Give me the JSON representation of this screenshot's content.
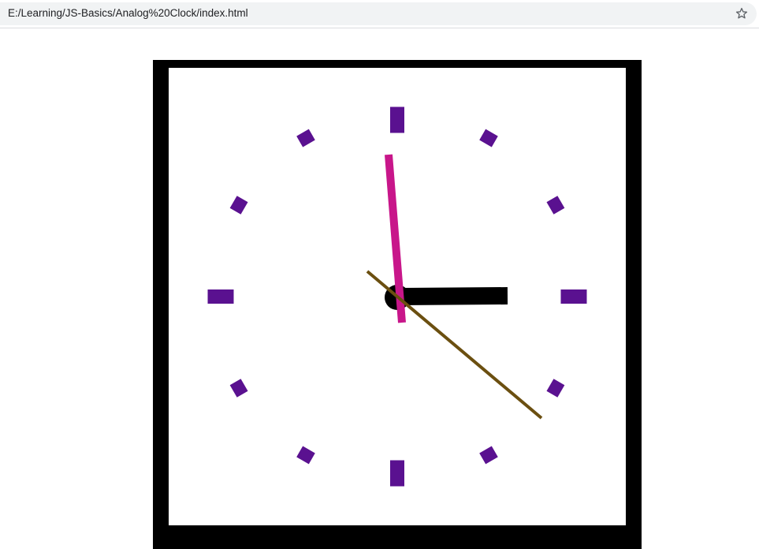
{
  "browser": {
    "url": "E:/Learning/JS-Basics/Analog%20Clock/index.html",
    "bookmark_icon": "star-outline-icon"
  },
  "clock": {
    "colors": {
      "frame": "#000000",
      "face": "#ffffff",
      "hour_marker": "#5a1190",
      "hour_hand": "#000000",
      "minute_hand": "#c8168a",
      "second_hand": "#6b4f10",
      "center_dot": "#000000"
    },
    "time": {
      "hours": 3,
      "minutes": 59,
      "seconds": 21
    },
    "marker_count": 12
  }
}
